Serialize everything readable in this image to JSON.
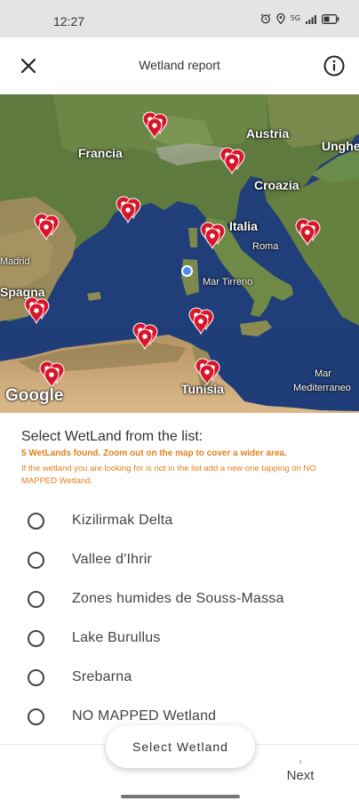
{
  "status_bar": {
    "time": "12:27",
    "network": "5G",
    "icons": [
      "alarm-icon",
      "location-icon",
      "signal-icon",
      "battery-icon"
    ]
  },
  "app_bar": {
    "title": "Wetland report",
    "close_icon": "close-icon",
    "info_icon": "info-icon"
  },
  "map": {
    "labels": [
      "Francia",
      "Austria",
      "Ungheria",
      "Croazia",
      "Italia",
      "Roma",
      "Madrid",
      "Spagna",
      "Mar Tirreno",
      "Tunisia",
      "Mar",
      "Mediterraneo"
    ],
    "attribution": "Google",
    "marker_color": "#d8152a",
    "location_color": "#4a8ef0"
  },
  "content": {
    "title": "Select WetLand from the list:",
    "found_text": "5 WetLands found. Zoom out on the map to cover a wider area.",
    "hint_text": "If the wetland you are looking for is not in the list add a new one tapping on NO MAPPED Wetland.",
    "accent_color": "#e0801e"
  },
  "wetlands": [
    {
      "label": "Kizilirmak Delta",
      "selected": false
    },
    {
      "label": "Vallee d'Ihrir",
      "selected": false
    },
    {
      "label": "Zones humides de Souss-Massa",
      "selected": false
    },
    {
      "label": "Lake Burullus",
      "selected": false
    },
    {
      "label": "Srebarna",
      "selected": false
    },
    {
      "label": "NO MAPPED Wetland",
      "selected": false
    }
  ],
  "actions": {
    "select_button": "Select Wetland",
    "next_button": "Next",
    "next_chevron": "›"
  }
}
